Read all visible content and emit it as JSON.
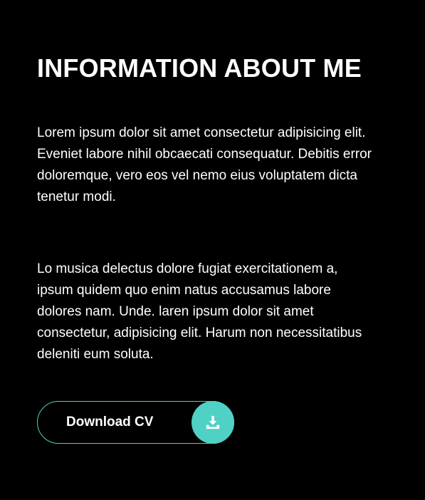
{
  "about": {
    "title": "INFORMATION ABOUT ME",
    "paragraphs": [
      "Lorem ipsum dolor sit amet consectetur adipisicing elit. Eveniet labore nihil obcaecati consequatur. Debitis error doloremque, vero eos vel nemo eius voluptatem dicta tenetur modi.",
      "Lo musica delectus dolore fugiat exercitationem a, ipsum quidem quo enim natus accusamus labore dolores nam. Unde. laren ipsum dolor sit amet consectetur, adipisicing elit. Harum non necessitatibus deleniti eum soluta."
    ],
    "download_button": {
      "label": "Download CV",
      "icon": "download-icon"
    }
  },
  "colors": {
    "background": "#000000",
    "text": "#ffffff",
    "accent": "#4fd1c5"
  }
}
